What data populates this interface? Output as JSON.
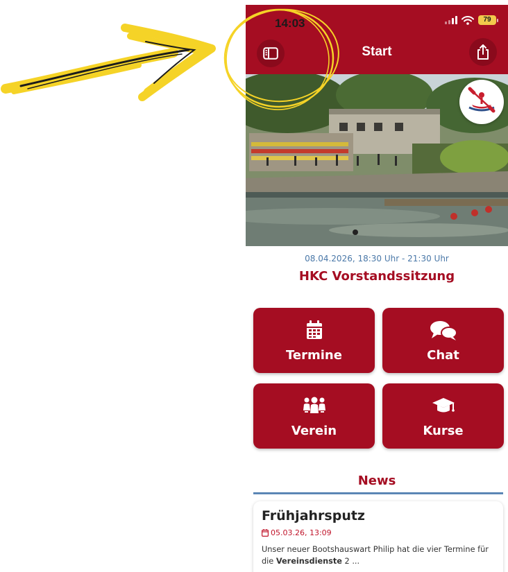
{
  "statusbar": {
    "time": "14:03",
    "battery": "79"
  },
  "header": {
    "title": "Start",
    "sidebar_icon": "sidebar-icon",
    "share_icon": "share-icon",
    "brand_color": "#a50d22"
  },
  "event": {
    "date": "08.04.2026, 18:30 Uhr - 21:30 Uhr",
    "title": "HKC Vorstandssitzung"
  },
  "tiles": [
    {
      "label": "Termine",
      "icon": "calendar-icon"
    },
    {
      "label": "Chat",
      "icon": "chat-icon"
    },
    {
      "label": "Verein",
      "icon": "users-icon"
    },
    {
      "label": "Kurse",
      "icon": "graduation-cap-icon"
    }
  ],
  "news": {
    "heading": "News",
    "items": [
      {
        "title": "Frühjahrsputz",
        "date": "05.03.26, 13:09",
        "snippet_before": "Unser neuer Bootshauswart Philip hat die vier Termine für die ",
        "snippet_bold": "Vereinsdienste",
        "snippet_after": " 2 ..."
      }
    ]
  },
  "annotation": {
    "arrow_color": "#f5d327",
    "circle_color": "#f5d327"
  }
}
